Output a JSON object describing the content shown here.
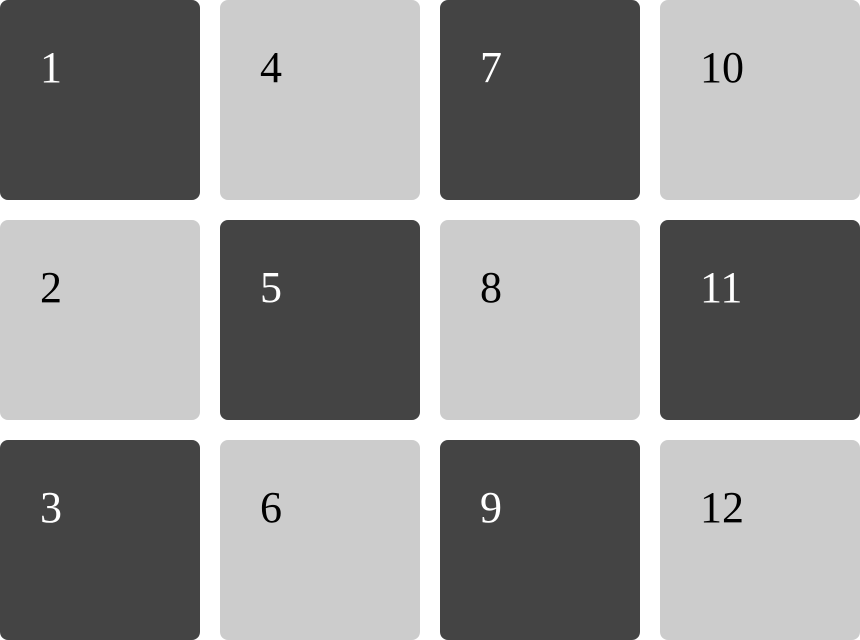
{
  "colors": {
    "dark_tile": "#444444",
    "light_tile": "#cccccc",
    "dark_text": "#ffffff",
    "light_text": "#000000",
    "background": "#ffffff"
  },
  "tiles": [
    {
      "label": "1",
      "shade": "dark"
    },
    {
      "label": "2",
      "shade": "light"
    },
    {
      "label": "3",
      "shade": "dark"
    },
    {
      "label": "4",
      "shade": "light"
    },
    {
      "label": "5",
      "shade": "dark"
    },
    {
      "label": "6",
      "shade": "light"
    },
    {
      "label": "7",
      "shade": "dark"
    },
    {
      "label": "8",
      "shade": "light"
    },
    {
      "label": "9",
      "shade": "dark"
    },
    {
      "label": "10",
      "shade": "light"
    },
    {
      "label": "11",
      "shade": "dark"
    },
    {
      "label": "12",
      "shade": "light"
    }
  ]
}
